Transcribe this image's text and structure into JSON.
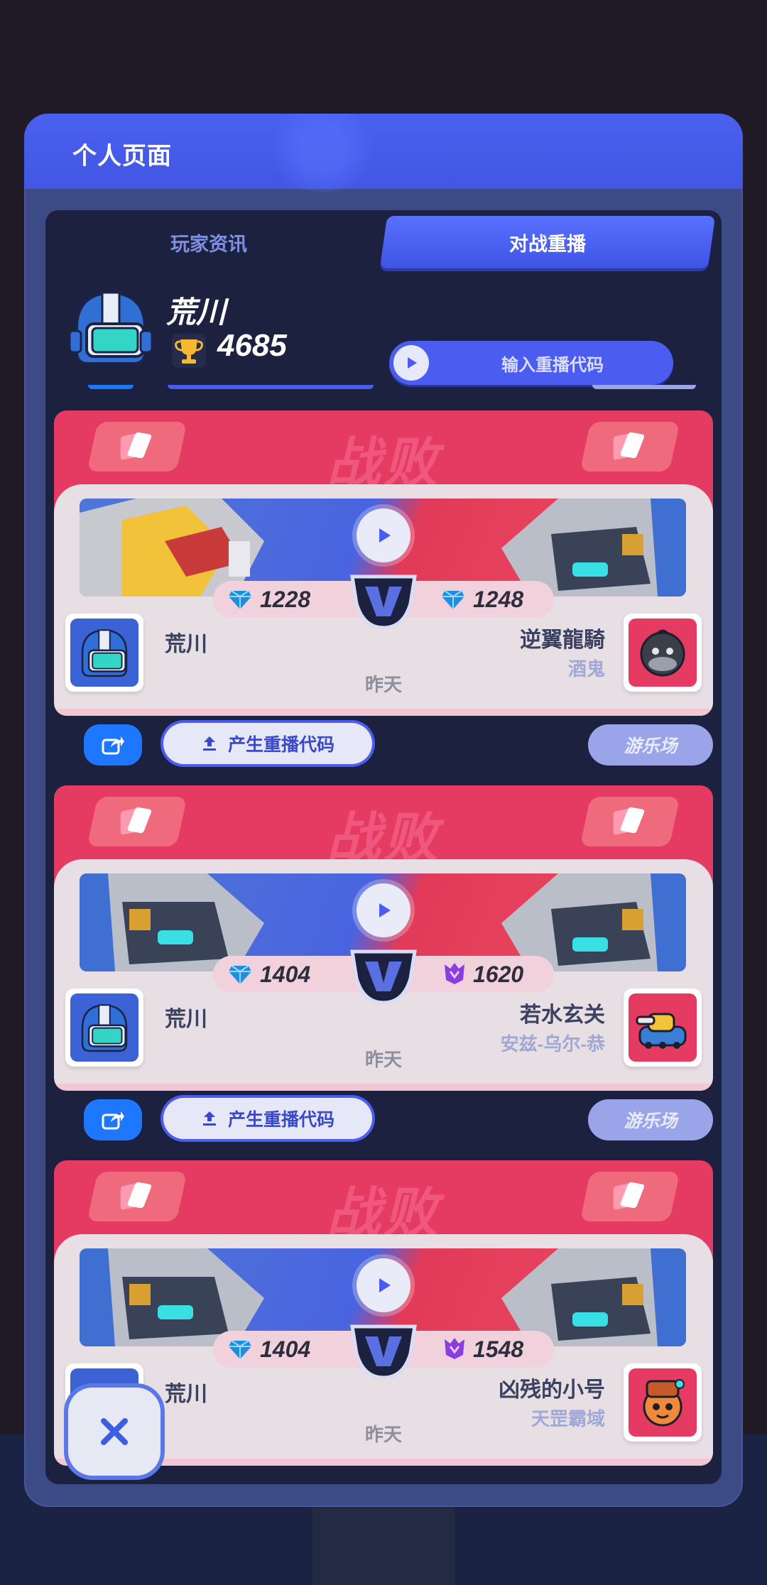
{
  "header": {
    "title": "个人页面"
  },
  "tabs": [
    {
      "label": "玩家资讯",
      "active": false
    },
    {
      "label": "对战重播",
      "active": true
    }
  ],
  "player": {
    "name": "荒川",
    "trophies": "4685",
    "avatar_icon": "helmet-icon"
  },
  "replay_input": {
    "label": "输入重播代码"
  },
  "matches": [
    {
      "result": "战败",
      "player_score": "1228",
      "player_rank_icon": "diamond-rank-icon",
      "opponent_score": "1248",
      "opponent_rank_icon": "diamond-rank-icon",
      "player_name": "荒川",
      "opponent_name": "逆翼龍騎",
      "opponent_club": "酒鬼",
      "time": "昨天",
      "opponent_avatar_color": "#e53a62",
      "actions": {
        "generate": "产生重播代码",
        "mode": "游乐场"
      }
    },
    {
      "result": "战败",
      "player_score": "1404",
      "player_rank_icon": "diamond-rank-icon",
      "opponent_score": "1620",
      "opponent_rank_icon": "mythic-rank-icon",
      "player_name": "荒川",
      "opponent_name": "若水玄关",
      "opponent_club": "安兹-乌尔-恭",
      "time": "昨天",
      "opponent_avatar_color": "#e53a62",
      "actions": {
        "generate": "产生重播代码",
        "mode": "游乐场"
      }
    },
    {
      "result": "战败",
      "player_score": "1404",
      "player_rank_icon": "diamond-rank-icon",
      "opponent_score": "1548",
      "opponent_rank_icon": "mythic-rank-icon",
      "player_name": "荒川",
      "opponent_name": "凶残的小号",
      "opponent_club": "天罡霸域",
      "time": "昨天",
      "opponent_avatar_color": "#e53a62"
    }
  ],
  "colors": {
    "accent": "#4b5cf0",
    "defeat": "#e53a62",
    "share": "#1e78ff",
    "panel": "#3c4a86"
  }
}
